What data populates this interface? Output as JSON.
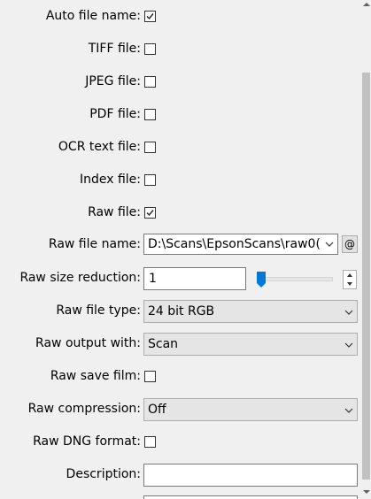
{
  "rows": {
    "auto_file_name": {
      "label": "Auto file name:",
      "checked": true
    },
    "tiff_file": {
      "label": "TIFF file:",
      "checked": false
    },
    "jpeg_file": {
      "label": "JPEG file:",
      "checked": false
    },
    "pdf_file": {
      "label": "PDF file:",
      "checked": false
    },
    "ocr_text_file": {
      "label": "OCR text file:",
      "checked": false
    },
    "index_file": {
      "label": "Index file:",
      "checked": false
    },
    "raw_file": {
      "label": "Raw file:",
      "checked": true
    },
    "raw_file_name": {
      "label": "Raw file name:",
      "value": "D:\\Scans\\EpsonScans\\raw0(",
      "button": "@"
    },
    "raw_size_reduction": {
      "label": "Raw size reduction:",
      "value": "1",
      "slider_fraction": 0.0
    },
    "raw_file_type": {
      "label": "Raw file type:",
      "value": "24 bit RGB"
    },
    "raw_output_with": {
      "label": "Raw output with:",
      "value": "Scan"
    },
    "raw_save_film": {
      "label": "Raw save film:",
      "checked": false
    },
    "raw_compression": {
      "label": "Raw compression:",
      "value": "Off"
    },
    "raw_dng_format": {
      "label": "Raw DNG format:",
      "checked": false
    },
    "description": {
      "label": "Description:",
      "value": ""
    }
  },
  "colors": {
    "accent": "#0078d7",
    "background": "#f0f0f0",
    "combo_bg": "#e5e5e5"
  }
}
